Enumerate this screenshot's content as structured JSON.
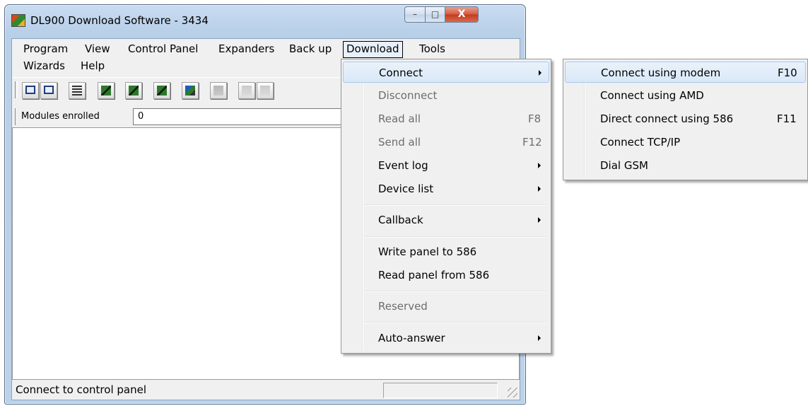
{
  "window": {
    "title": "DL900 Download Software - 3434",
    "controls": {
      "minimize": "–",
      "maximize": "□",
      "close": "X"
    }
  },
  "menubar": {
    "items": [
      {
        "label": "Program"
      },
      {
        "label": "View"
      },
      {
        "label": "Control Panel"
      },
      {
        "label": "Expanders"
      },
      {
        "label": "Back up"
      },
      {
        "label": "Download"
      },
      {
        "label": "Tools"
      },
      {
        "label": "Wizards"
      },
      {
        "label": "Help"
      }
    ],
    "active": "Download"
  },
  "toolbar": {
    "icons": [
      "connect-icon",
      "disconnect-icon",
      "keypad-icon",
      "modules-icon",
      "panel-icon",
      "read-icon",
      "send-icon",
      "cancel-icon",
      "upload-icon",
      "download-icon"
    ]
  },
  "modules": {
    "label": "Modules enrolled",
    "value": "0"
  },
  "statusbar": {
    "text": "Connect to control panel"
  },
  "download_menu": {
    "items": [
      {
        "label": "Connect",
        "submenu": true,
        "disabled": false,
        "highlighted": true
      },
      {
        "label": "Disconnect",
        "disabled": true
      },
      {
        "label": "Read all",
        "shortcut": "F8",
        "disabled": true
      },
      {
        "label": "Send all",
        "shortcut": "F12",
        "disabled": true
      },
      {
        "label": "Event log",
        "submenu": true,
        "disabled": false
      },
      {
        "label": "Device list",
        "submenu": true,
        "disabled": false
      },
      {
        "label": "Callback",
        "submenu": true,
        "disabled": false
      },
      {
        "label": "Write panel to 586",
        "disabled": false
      },
      {
        "label": "Read panel from 586",
        "disabled": false
      },
      {
        "label": "Reserved",
        "disabled": true
      },
      {
        "label": "Auto-answer",
        "submenu": true,
        "disabled": false
      }
    ]
  },
  "connect_submenu": {
    "items": [
      {
        "label": "Connect using modem",
        "shortcut": "F10",
        "highlighted": true
      },
      {
        "label": "Connect using AMD"
      },
      {
        "label": "Direct connect using 586",
        "shortcut": "F11"
      },
      {
        "label": "Connect TCP/IP"
      },
      {
        "label": "Dial GSM"
      }
    ]
  }
}
